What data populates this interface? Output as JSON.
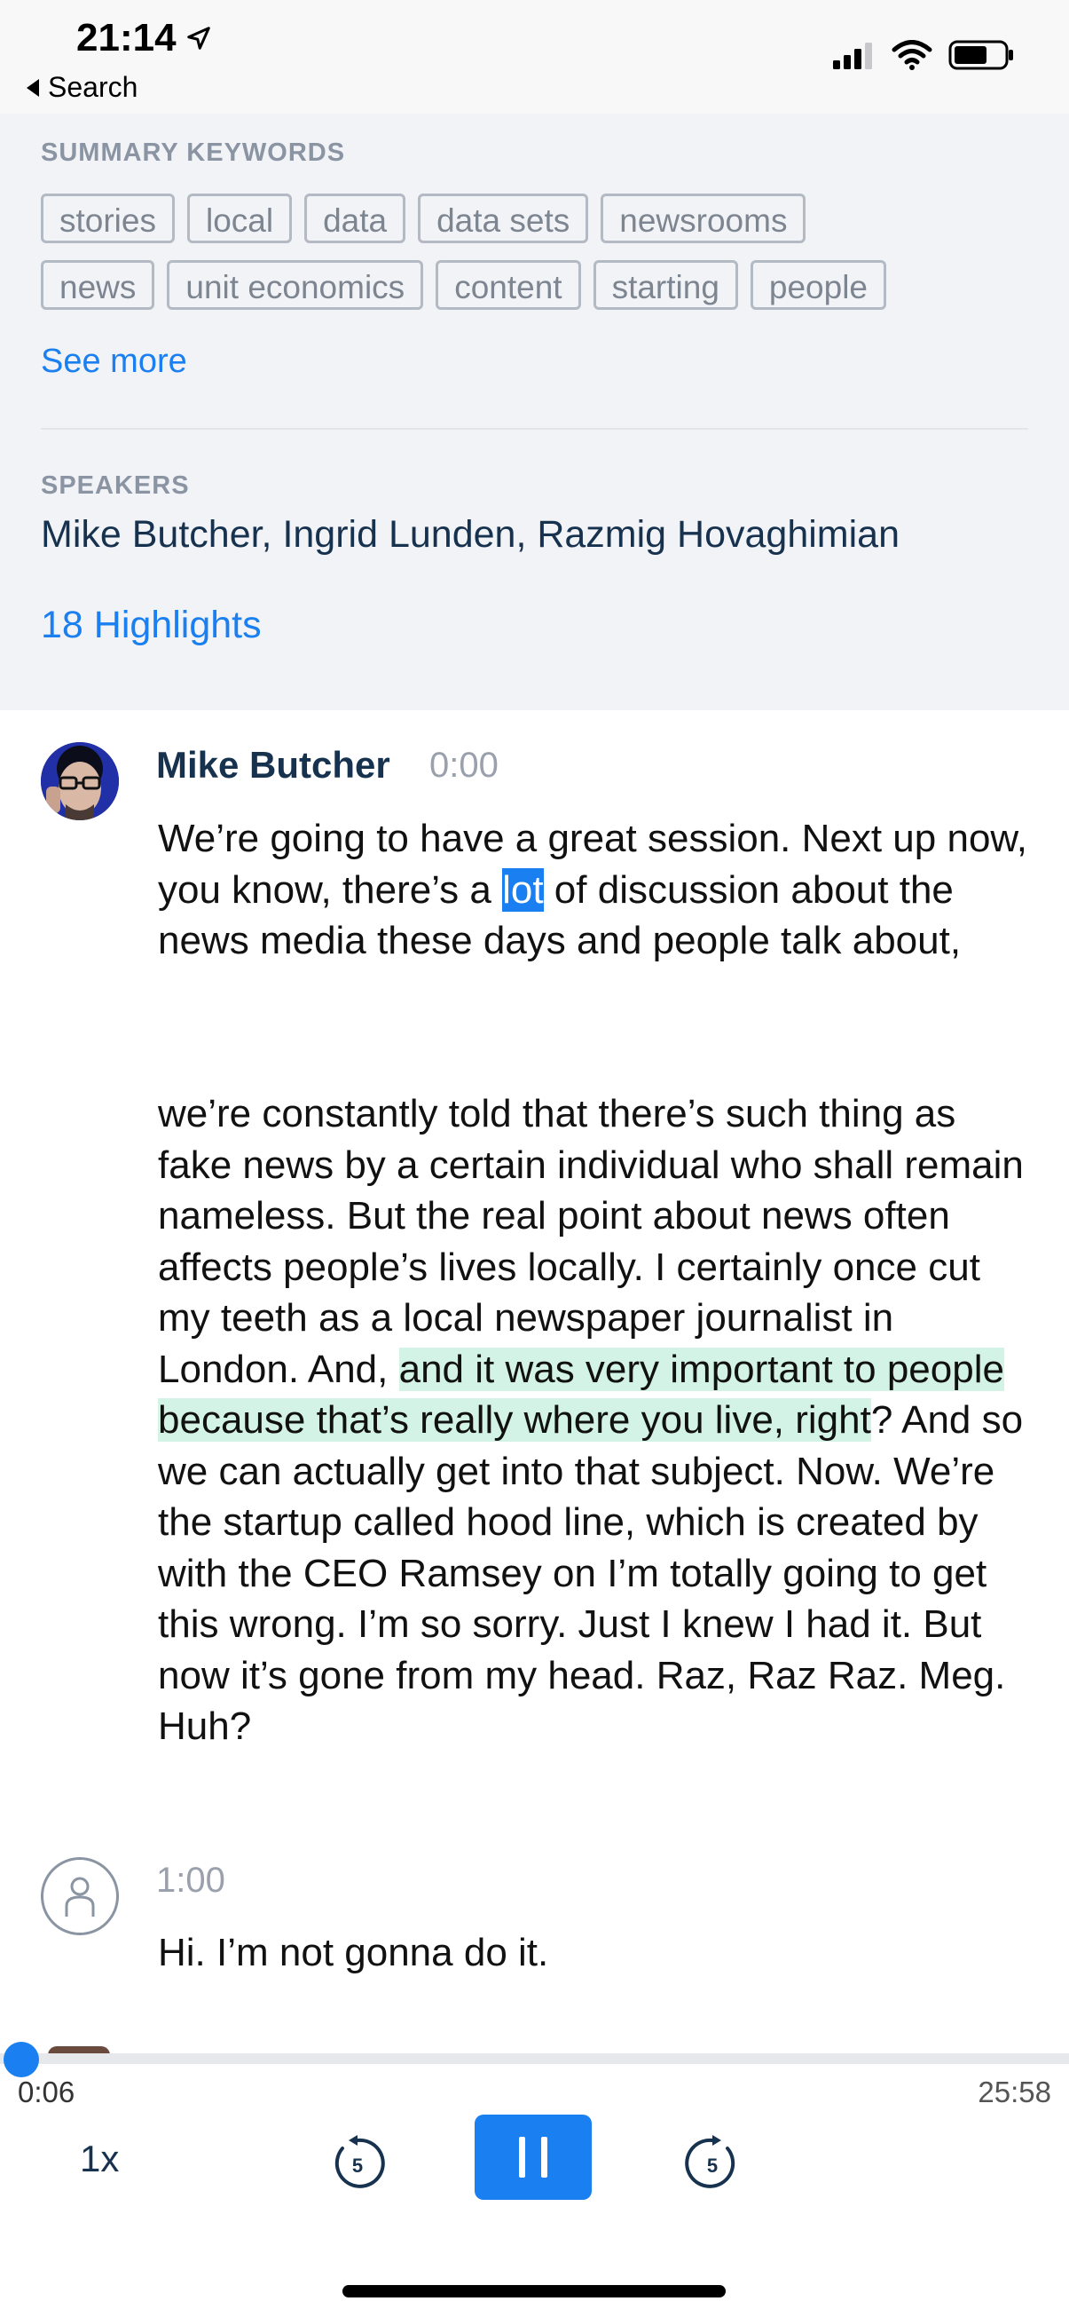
{
  "status_bar": {
    "time": "21:14",
    "back_label": "Search",
    "icons": [
      "location-arrow-icon",
      "signal-icon",
      "wifi-icon",
      "battery-icon"
    ]
  },
  "summary": {
    "label": "SUMMARY KEYWORDS",
    "keywords_row1": [
      "stories",
      "local",
      "data",
      "data sets",
      "newsrooms"
    ],
    "keywords_row2": [
      "news",
      "unit economics",
      "content",
      "starting",
      "people"
    ],
    "see_more": "See more"
  },
  "speakers": {
    "label": "SPEAKERS",
    "value": "Mike Butcher, Ingrid Lunden, Razmig Hovaghimian"
  },
  "highlights_link": "18 Highlights",
  "transcript": [
    {
      "speaker": "Mike Butcher",
      "time": "0:00",
      "p1_before": "We’re going to have a great session. Next up now, you know, there’s a ",
      "p1_selected": "lot",
      "p1_after": " of discussion about the news media these days and people talk about,",
      "p2_before": "we’re constantly told that there’s such thing as fake news by a certain individual who shall remain nameless. But the real point about news often affects people’s lives locally. I certainly once cut my teeth as a local newspaper journalist in London. And, ",
      "p2_highlight": "and it was very important to people because that’s really where you live, right",
      "p2_after": "? And so we can actually get into that subject. Now. We’re the startup called hood line, which is created by with the CEO Ramsey on I’m totally going to get this wrong. I’m so sorry. Just I knew I had it. But now it’s gone from my head. Raz, Raz Raz. Meg. Huh?"
    },
    {
      "speaker": "",
      "time": "1:00",
      "text": "Hi. I’m not gonna do it."
    }
  ],
  "player": {
    "elapsed": "0:06",
    "duration": "25:58",
    "speed": "1x",
    "skip_seconds": "5",
    "progress_fraction": 0.004
  },
  "colors": {
    "accent": "#1a7ff0",
    "highlight": "#d3f3e6",
    "panel_bg": "#f2f3f6",
    "name": "#17324f"
  }
}
